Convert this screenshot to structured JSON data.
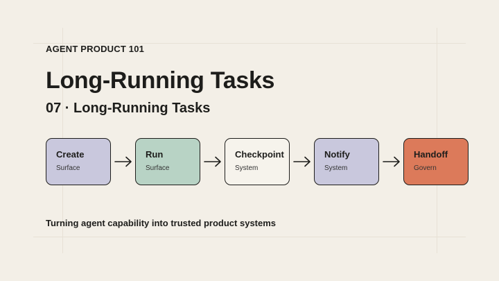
{
  "eyebrow": "AGENT PRODUCT 101",
  "title": "Long-Running Tasks",
  "subtitle": "07 · Long-Running Tasks",
  "flow": [
    {
      "label": "Create",
      "sub": "Surface",
      "color": "#c9c8dd"
    },
    {
      "label": "Run",
      "sub": "Surface",
      "color": "#b8d3c5"
    },
    {
      "label": "Checkpoint",
      "sub": "System",
      "color": "#f6f3ec"
    },
    {
      "label": "Notify",
      "sub": "System",
      "color": "#c9c8dd"
    },
    {
      "label": "Handoff",
      "sub": "Govern",
      "color": "#dc7a5a"
    }
  ],
  "footer": "Turning agent capability into trusted product systems"
}
